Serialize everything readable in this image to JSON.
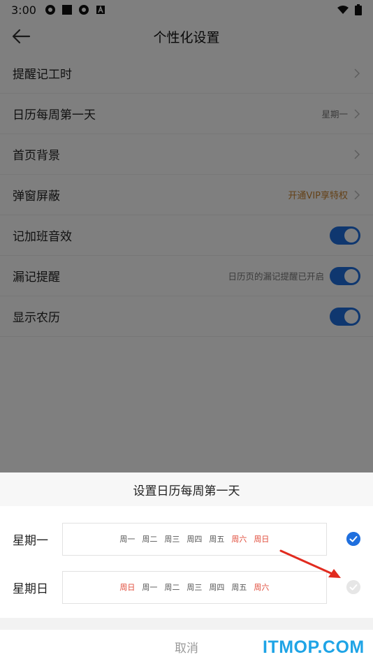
{
  "status_bar": {
    "time": "3:00",
    "icons": [
      "settings-gear-icon",
      "square-icon",
      "settings-gear-icon",
      "a-icon"
    ],
    "right_icons": [
      "wifi-icon",
      "battery-icon"
    ]
  },
  "header": {
    "title": "个性化设置"
  },
  "settings": [
    {
      "label": "提醒记工时",
      "value": "",
      "control": "chevron"
    },
    {
      "label": "日历每周第一天",
      "value": "星期一",
      "control": "chevron"
    },
    {
      "label": "首页背景",
      "value": "",
      "control": "chevron"
    },
    {
      "label": "弹窗屏蔽",
      "value": "开通VIP享特权",
      "control": "chevron"
    },
    {
      "label": "记加班音效",
      "value": "",
      "control": "toggle",
      "on": true
    },
    {
      "label": "漏记提醒",
      "value": "日历页的漏记提醒已开启",
      "control": "toggle",
      "on": true
    },
    {
      "label": "显示农历",
      "value": "",
      "control": "toggle",
      "on": true
    }
  ],
  "sheet": {
    "title": "设置日历每周第一天",
    "options": [
      {
        "name": "星期一",
        "days": [
          "周一",
          "周二",
          "周三",
          "周四",
          "周五",
          "周六",
          "周日"
        ],
        "selected": true
      },
      {
        "name": "星期日",
        "days": [
          "周日",
          "周一",
          "周二",
          "周三",
          "周四",
          "周五",
          "周六"
        ],
        "selected": false
      }
    ],
    "cancel_label": "取消"
  },
  "watermark": "ITMOP.COM",
  "colors": {
    "accent": "#1f6fde",
    "weekend": "#e04b3a",
    "vip": "#c8822e",
    "watermark": "#1fa4e6"
  }
}
